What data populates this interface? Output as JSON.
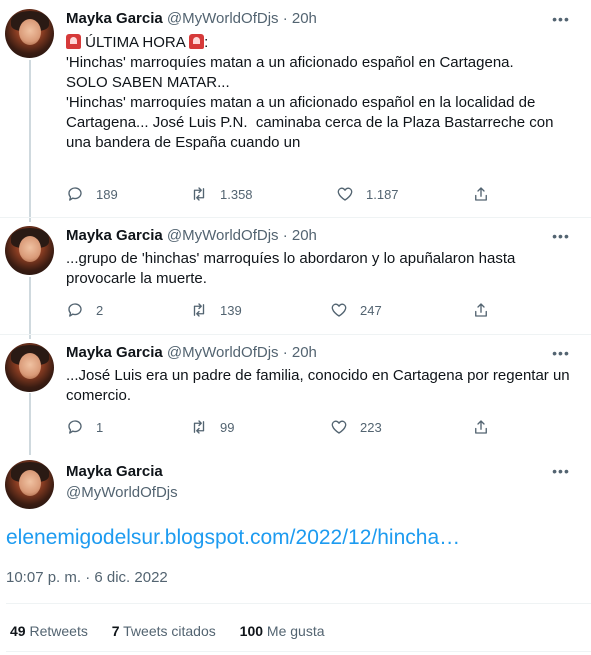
{
  "author": {
    "name": "Mayka Garcia",
    "handle": "@MyWorldOfDjs",
    "separator": "·"
  },
  "tweets": [
    {
      "time": "20h",
      "text_lines": [
        "ÚLTIMA HORA",
        "",
        "'Hinchas' marroquíes matan a un aficionado español en Cartagena.",
        "SOLO SABEN MATAR...",
        "'Hinchas' marroquíes matan a un aficionado español en la localidad de",
        "Cartagena... José Luis P.N.  caminaba cerca de la Plaza Bastarreche con",
        "una bandera de España cuando un"
      ],
      "alarm_suffix": ":",
      "replies": "189",
      "retweets": "1.358",
      "likes": "1.187"
    },
    {
      "time": "20h",
      "text_lines": [
        "...grupo de 'hinchas' marroquíes lo abordaron y lo apuñalaron hasta",
        "provocarle la muerte."
      ],
      "replies": "2",
      "retweets": "139",
      "likes": "247"
    },
    {
      "time": "20h",
      "text_lines": [
        "...José Luis era un padre de familia, conocido en Cartagena por regentar un",
        "comercio."
      ],
      "replies": "1",
      "retweets": "99",
      "likes": "223"
    }
  ],
  "main_tweet": {
    "link": "elenemigodelsur.blogspot.com/2022/12/hincha…",
    "timestamp": "10:07 p. m. · 6 dic. 2022",
    "stats": {
      "retweets_count": "49",
      "retweets_label": "Retweets",
      "quotes_count": "7",
      "quotes_label": "Tweets citados",
      "likes_count": "100",
      "likes_label": "Me gusta"
    }
  },
  "icons": [
    "reply-icon",
    "retweet-icon",
    "like-icon",
    "share-icon",
    "more-icon",
    "alarm-icon"
  ],
  "colors": {
    "link": "#1d9bf0",
    "secondary_text": "#536471",
    "primary_text": "#0f1419",
    "thread_line": "#cfd9de"
  }
}
